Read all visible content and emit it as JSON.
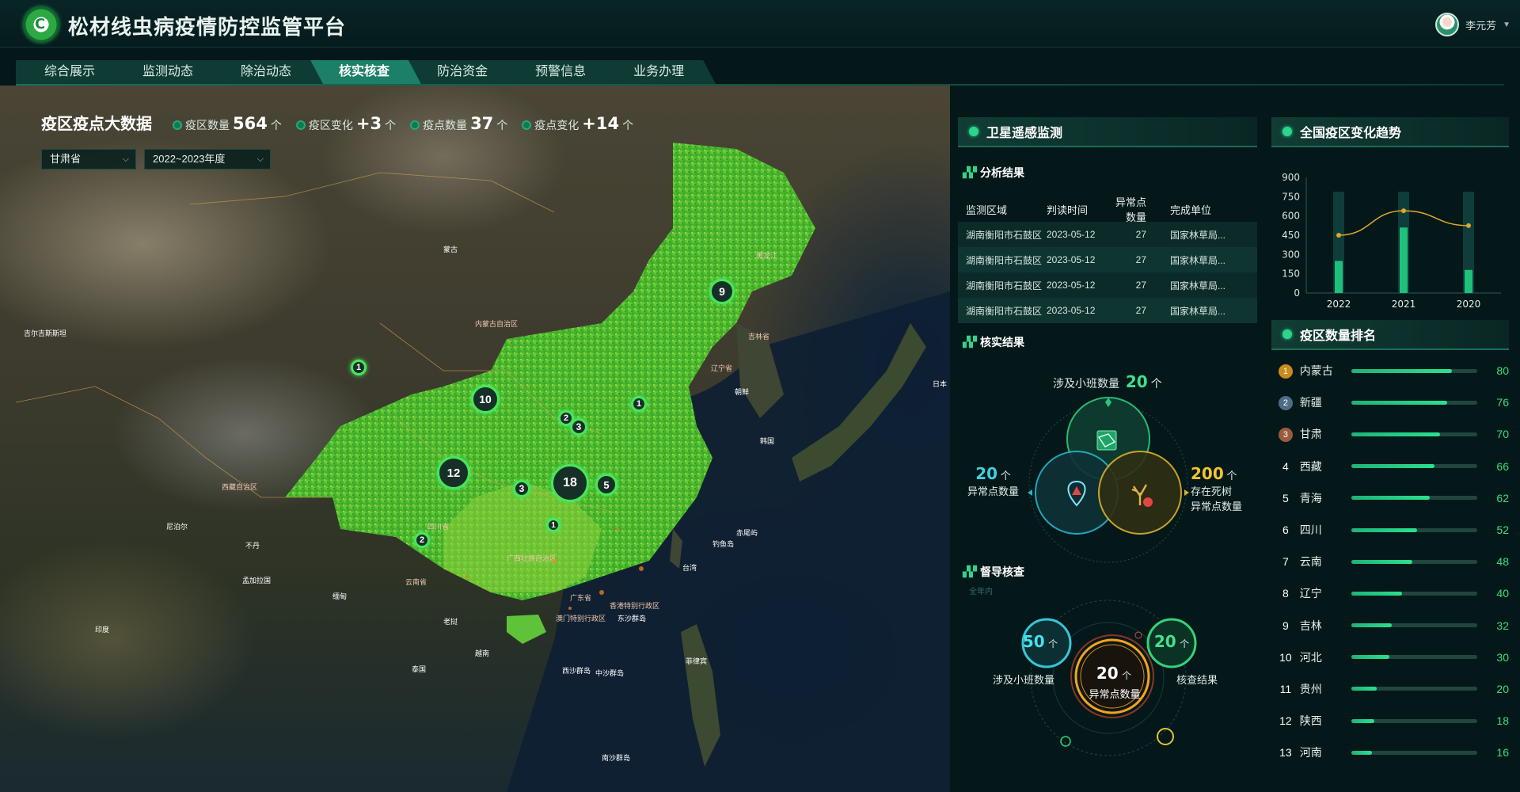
{
  "header": {
    "title": "松材线虫病疫情防控监管平台",
    "logo_text": "C",
    "user_name": "李元芳"
  },
  "nav": {
    "tabs": [
      {
        "label": "综合展示",
        "active": false
      },
      {
        "label": "监测动态",
        "active": false
      },
      {
        "label": "除治动态",
        "active": false
      },
      {
        "label": "核实核查",
        "active": true
      },
      {
        "label": "防治资金",
        "active": false
      },
      {
        "label": "预警信息",
        "active": false
      },
      {
        "label": "业务办理",
        "active": false
      }
    ]
  },
  "summary": {
    "title": "疫区疫点大数据",
    "stats": [
      {
        "label": "疫区数量",
        "value": "564",
        "unit": "个"
      },
      {
        "label": "疫区变化",
        "value": "+3",
        "unit": "个"
      },
      {
        "label": "疫点数量",
        "value": "37",
        "unit": "个"
      },
      {
        "label": "疫点变化",
        "value": "+14",
        "unit": "个"
      }
    ],
    "filters": {
      "province": "甘肃省",
      "year": "2022~2023年度"
    }
  },
  "map": {
    "clusters": [
      "9",
      "10",
      "12",
      "18",
      "5",
      "3",
      "3",
      "2",
      "1",
      "1",
      "1",
      "2"
    ],
    "place_labels": [
      "黑龙江",
      "吉林省",
      "辽宁省",
      "朝鲜",
      "韩国",
      "日本",
      "内蒙古自治区",
      "四川省",
      "西藏自治区",
      "云南省",
      "广西壮族自治区",
      "广东省",
      "台湾",
      "钓鱼岛",
      "赤尾屿",
      "香港特别行政区",
      "澳门特别行政区",
      "东沙群岛",
      "西沙群岛",
      "中沙群岛",
      "南沙群岛",
      "菲律宾",
      "老挝",
      "越南",
      "泰国",
      "缅甸",
      "印度",
      "尼泊尔",
      "不丹",
      "孟加拉国",
      "吉尔吉斯斯坦",
      "蒙古"
    ]
  },
  "satellite": {
    "title": "卫星遥感监测",
    "analysis_title": "分析结果",
    "columns": [
      "监测区域",
      "判读时间",
      "异常点数量",
      "完成单位"
    ],
    "rows": [
      [
        "湖南衡阳市石鼓区",
        "2023-05-12",
        "27",
        "国家林草局..."
      ],
      [
        "湖南衡阳市石鼓区",
        "2023-05-12",
        "27",
        "国家林草局..."
      ],
      [
        "湖南衡阳市石鼓区",
        "2023-05-12",
        "27",
        "国家林草局..."
      ],
      [
        "湖南衡阳市石鼓区",
        "2023-05-12",
        "27",
        "国家林草局..."
      ]
    ],
    "verify_title": "核实结果",
    "verify": {
      "top": {
        "label": "涉及小班数量",
        "value": "20",
        "unit": "个"
      },
      "left": {
        "value": "20",
        "unit": "个",
        "label": "异常点数量"
      },
      "right": {
        "value": "200",
        "unit": "个",
        "label1": "存在死树",
        "label2": "异常点数量"
      }
    },
    "supervise_title": "督导核查",
    "supervise_sub": "全年内",
    "supervise": {
      "left": {
        "value": "50",
        "unit": "个",
        "label": "涉及小班数量"
      },
      "center": {
        "value": "20",
        "unit": "个",
        "label": "异常点数量"
      },
      "right": {
        "value": "20",
        "unit": "个",
        "label": "核查结果"
      }
    }
  },
  "trend": {
    "title": "全国疫区变化趋势",
    "chart_data": {
      "type": "bar",
      "categories": [
        "2022",
        "2021",
        "2020"
      ],
      "series": [
        {
          "name": "bar",
          "values": [
            250,
            510,
            180
          ]
        },
        {
          "name": "line",
          "values": [
            450,
            640,
            525
          ]
        }
      ],
      "ylim": [
        0,
        900
      ],
      "yticks": [
        0,
        150,
        300,
        450,
        600,
        750,
        900
      ],
      "colors": {
        "bar": "#1fc07a",
        "line": "#e0a72a",
        "track": "#0f3d3a"
      }
    }
  },
  "ranking": {
    "title": "疫区数量排名",
    "max": 100,
    "items": [
      {
        "rank": "1",
        "name": "内蒙古",
        "value": 80,
        "medal": "#c98b1c"
      },
      {
        "rank": "2",
        "name": "新疆",
        "value": 76,
        "medal": "#4f6c86"
      },
      {
        "rank": "3",
        "name": "甘肃",
        "value": 70,
        "medal": "#9a5b3c"
      },
      {
        "rank": "4",
        "name": "西藏",
        "value": 66
      },
      {
        "rank": "5",
        "name": "青海",
        "value": 62
      },
      {
        "rank": "6",
        "name": "四川",
        "value": 52
      },
      {
        "rank": "7",
        "name": "云南",
        "value": 48
      },
      {
        "rank": "8",
        "name": "辽宁",
        "value": 40
      },
      {
        "rank": "9",
        "name": "吉林",
        "value": 32
      },
      {
        "rank": "10",
        "name": "河北",
        "value": 30
      },
      {
        "rank": "11",
        "name": "贵州",
        "value": 20
      },
      {
        "rank": "12",
        "name": "陕西",
        "value": 18
      },
      {
        "rank": "13",
        "name": "河南",
        "value": 16
      }
    ]
  }
}
